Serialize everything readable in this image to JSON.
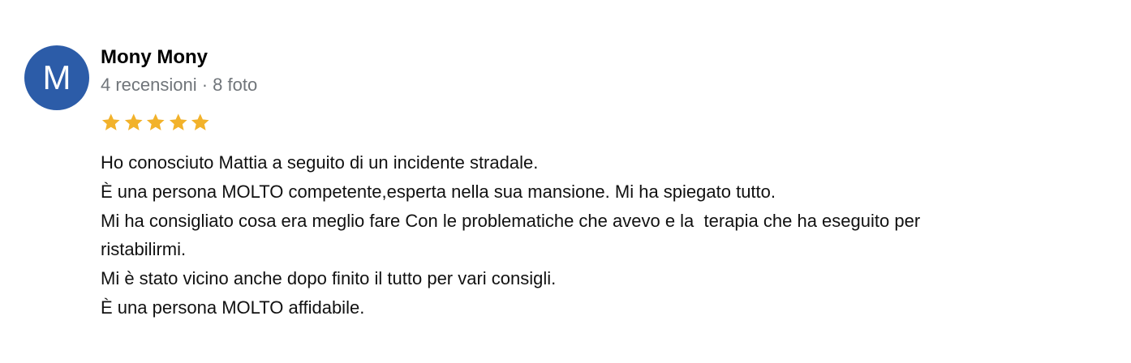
{
  "review": {
    "avatar": {
      "initial": "M",
      "color": "#2c5ca8"
    },
    "author": "Mony Mony",
    "meta": "4 recensioni · 8 foto",
    "rating": 5,
    "star_color": "#f2b22b",
    "lines": [
      "Ho conosciuto Mattia a seguito di un incidente stradale.",
      "È una persona MOLTO competente,esperta nella sua mansione. Mi ha spiegato tutto.",
      "Mi ha consigliato cosa era meglio fare Con le problematiche che avevo e la  terapia che ha eseguito per",
      "ristabilirmi.",
      "Mi è stato vicino anche dopo finito il tutto per vari consigli.",
      "È una persona MOLTO affidabile."
    ]
  }
}
